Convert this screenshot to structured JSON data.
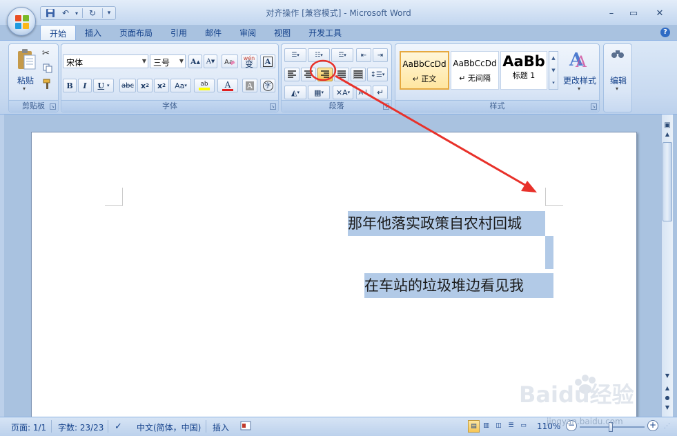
{
  "window": {
    "title": "对齐操作 [兼容模式] - Microsoft Word"
  },
  "tabs": [
    "开始",
    "插入",
    "页面布局",
    "引用",
    "邮件",
    "审阅",
    "视图",
    "开发工具"
  ],
  "ribbon": {
    "clipboard": {
      "label": "剪贴板",
      "paste_label": "粘贴"
    },
    "font": {
      "label": "字体",
      "font_name": "宋体",
      "font_size": "三号",
      "phonetic_glyph": "wén",
      "phonetic_char": "变"
    },
    "paragraph": {
      "label": "段落"
    },
    "styles": {
      "label": "样式",
      "items": [
        {
          "sample": "AaBbCcDd",
          "name": "↵ 正文"
        },
        {
          "sample": "AaBbCcDd",
          "name": "↵ 无间隔"
        },
        {
          "sample": "AaBb",
          "name": "标题 1"
        }
      ],
      "change_styles_label": "更改样式"
    },
    "editing": {
      "label": "编辑"
    }
  },
  "document": {
    "lines": [
      "那年他落实政策自农村回城",
      "在车站的垃圾堆边看见我"
    ]
  },
  "statusbar": {
    "page": "页面: 1/1",
    "words": "字数: 23/23",
    "language": "中文(简体，中国)",
    "mode": "插入",
    "zoom": "110%"
  },
  "watermark": {
    "brand": "Baidu经验",
    "url": "jingyan.baidu.com"
  },
  "colors": {
    "annotation": "#e8312a",
    "selection": "#b2cae7",
    "ribbon_text": "#15428b"
  }
}
